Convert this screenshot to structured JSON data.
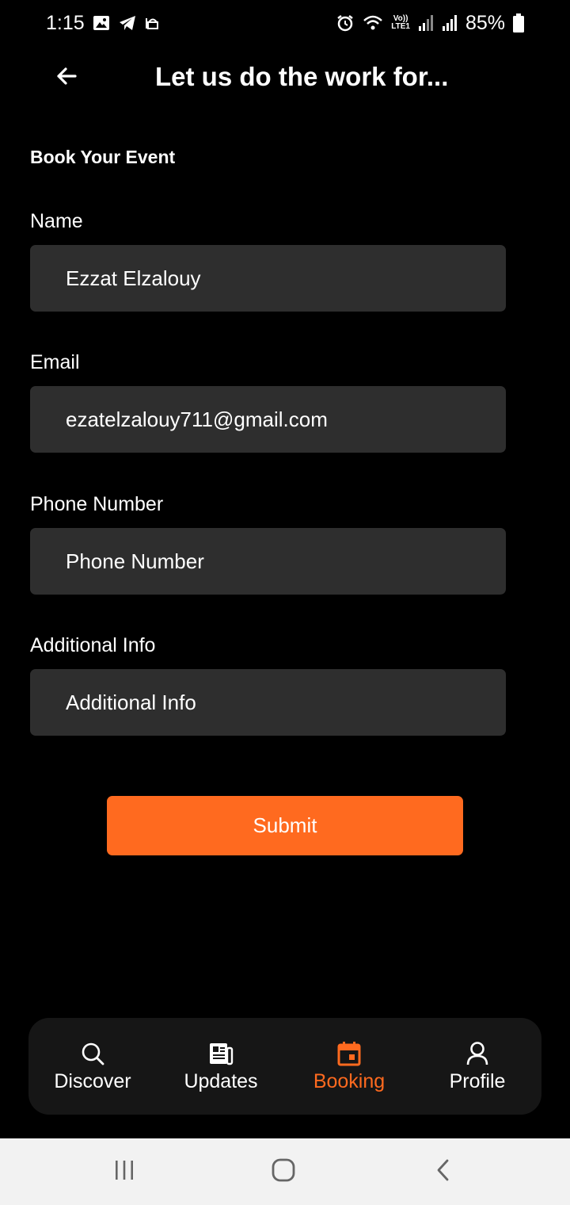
{
  "status_bar": {
    "time": "1:15",
    "lte_top": "Vo))",
    "lte_bottom": "LTE1",
    "battery": "85%"
  },
  "app_bar": {
    "title": "Let us do the work for..."
  },
  "form": {
    "heading": "Book Your Event",
    "name_label": "Name",
    "name_value": "Ezzat Elzalouy",
    "email_label": "Email",
    "email_value": "ezatelzalouy711@gmail.com",
    "phone_label": "Phone Number",
    "phone_placeholder": "Phone Number",
    "info_label": "Additional Info",
    "info_placeholder": "Additional Info",
    "submit_label": "Submit"
  },
  "bottom_nav": {
    "items": [
      {
        "label": "Discover",
        "icon": "search-icon"
      },
      {
        "label": "Updates",
        "icon": "newspaper-icon"
      },
      {
        "label": "Booking",
        "icon": "calendar-icon",
        "active": true
      },
      {
        "label": "Profile",
        "icon": "person-icon"
      }
    ]
  },
  "colors": {
    "accent": "#ff6a1f",
    "background": "#000000",
    "field_background": "#2e2e2e",
    "nav_background": "#161616"
  }
}
